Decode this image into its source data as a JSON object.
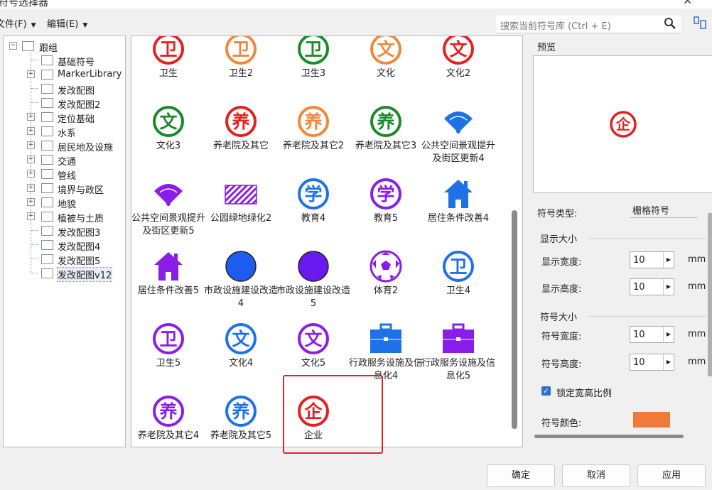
{
  "window": {
    "title": "符号选择器",
    "close_glyph": "✕"
  },
  "menu": {
    "file": "文件(F)",
    "edit": "编辑(E)"
  },
  "search": {
    "placeholder": "搜索当前符号库 (Ctrl + E)",
    "icon": "search-icon"
  },
  "tree": {
    "root": "跟组",
    "items": [
      {
        "label": "基础符号",
        "expandable": false
      },
      {
        "label": "MarkerLibrary",
        "expandable": true
      },
      {
        "label": "发改配图",
        "expandable": false
      },
      {
        "label": "发改配图2",
        "expandable": false
      },
      {
        "label": "定位基础",
        "expandable": true
      },
      {
        "label": "水系",
        "expandable": true
      },
      {
        "label": "居民地及设施",
        "expandable": true
      },
      {
        "label": "交通",
        "expandable": true
      },
      {
        "label": "管线",
        "expandable": true
      },
      {
        "label": "境界与政区",
        "expandable": true
      },
      {
        "label": "地貌",
        "expandable": true
      },
      {
        "label": "植被与土质",
        "expandable": true
      },
      {
        "label": "发改配图3",
        "expandable": false
      },
      {
        "label": "发改配图4",
        "expandable": false
      },
      {
        "label": "发改配图5",
        "expandable": false
      },
      {
        "label": "发改配图v12",
        "expandable": false,
        "selected": true
      }
    ]
  },
  "symbols": [
    {
      "label": "卫生",
      "glyph": "卫",
      "kind": "circle-char",
      "color": "#e52020"
    },
    {
      "label": "卫生2",
      "glyph": "卫",
      "kind": "circle-char",
      "color": "#f0883c"
    },
    {
      "label": "卫生3",
      "glyph": "卫",
      "kind": "circle-char",
      "color": "#1a8a2a"
    },
    {
      "label": "文化",
      "glyph": "文",
      "kind": "circle-char",
      "color": "#f0883c"
    },
    {
      "label": "文化2",
      "glyph": "文",
      "kind": "circle-char",
      "color": "#e52020"
    },
    {
      "label": "文化3",
      "glyph": "文",
      "kind": "circle-char",
      "color": "#1a8a2a"
    },
    {
      "label": "养老院及其它",
      "glyph": "养",
      "kind": "circle-char",
      "color": "#e52020"
    },
    {
      "label": "养老院及其它2",
      "glyph": "养",
      "kind": "circle-char",
      "color": "#f0883c"
    },
    {
      "label": "养老院及其它3",
      "glyph": "养",
      "kind": "circle-char",
      "color": "#1a8a2a"
    },
    {
      "label": "公共空间景观提升及街区更新4",
      "glyph": "",
      "kind": "fan",
      "color": "#1e72e8"
    },
    {
      "label": "公共空间景观提升及街区更新5",
      "glyph": "",
      "kind": "fan",
      "color": "#8a1ee8"
    },
    {
      "label": "公园绿地绿化2",
      "glyph": "",
      "kind": "hatch",
      "color": "#8a1ee8"
    },
    {
      "label": "教育4",
      "glyph": "学",
      "kind": "circle-char",
      "color": "#1e72e8"
    },
    {
      "label": "教育5",
      "glyph": "学",
      "kind": "circle-char",
      "color": "#8a1ee8"
    },
    {
      "label": "居住条件改善4",
      "glyph": "",
      "kind": "house",
      "color": "#1e72e8"
    },
    {
      "label": "居住条件改善5",
      "glyph": "",
      "kind": "house",
      "color": "#8a1ee8"
    },
    {
      "label": "市政设施建设改造4",
      "glyph": "",
      "kind": "dot",
      "color": "#1e5cf0"
    },
    {
      "label": "市政设施建设改造5",
      "glyph": "",
      "kind": "dot",
      "color": "#6a18f0"
    },
    {
      "label": "体育2",
      "glyph": "",
      "kind": "ball",
      "color": "#8a1ee8"
    },
    {
      "label": "卫生4",
      "glyph": "卫",
      "kind": "circle-char",
      "color": "#1e72e8"
    },
    {
      "label": "卫生5",
      "glyph": "卫",
      "kind": "circle-char",
      "color": "#8a1ee8"
    },
    {
      "label": "文化4",
      "glyph": "文",
      "kind": "circle-char",
      "color": "#1e72e8"
    },
    {
      "label": "文化5",
      "glyph": "文",
      "kind": "circle-char",
      "color": "#8a1ee8"
    },
    {
      "label": "行政服务设施及信息化4",
      "glyph": "",
      "kind": "case",
      "color": "#1e72e8"
    },
    {
      "label": "行政服务设施及信息化5",
      "glyph": "",
      "kind": "case",
      "color": "#8a1ee8"
    },
    {
      "label": "养老院及其它4",
      "glyph": "养",
      "kind": "circle-char",
      "color": "#8a1ee8"
    },
    {
      "label": "养老院及其它5",
      "glyph": "养",
      "kind": "circle-char",
      "color": "#1e72e8"
    },
    {
      "label": "企业",
      "glyph": "企",
      "kind": "circle-char",
      "color": "#e52020",
      "selected": true
    }
  ],
  "preview": {
    "title": "预览",
    "glyph": "企",
    "color": "#e52020"
  },
  "props": {
    "symbol_type_label": "符号类型:",
    "symbol_type_value": "栅格符号",
    "display_size_group": "显示大小",
    "display_width_label": "显示宽度:",
    "display_width_value": "10",
    "display_height_label": "显示高度:",
    "display_height_value": "10",
    "symbol_size_group": "符号大小",
    "symbol_width_label": "符号宽度:",
    "symbol_width_value": "10",
    "symbol_height_label": "符号高度:",
    "symbol_height_value": "10",
    "unit": "mm",
    "lock_ratio_label": "锁定宽高比例",
    "lock_ratio_checked": true,
    "symbol_color_label": "符号颜色:",
    "symbol_color": "#f07a3c"
  },
  "buttons": {
    "ok": "确定",
    "cancel": "取消",
    "apply": "应用"
  }
}
